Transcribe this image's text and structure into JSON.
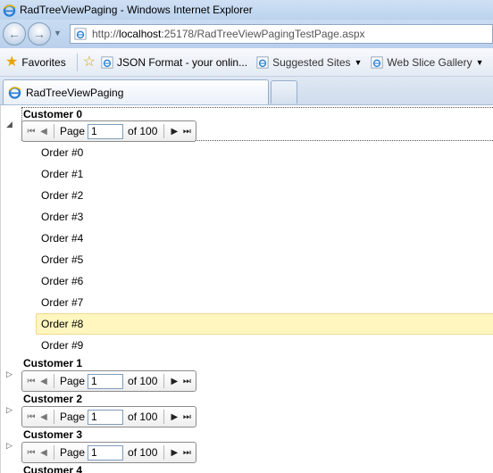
{
  "window": {
    "title": "RadTreeViewPaging - Windows Internet Explorer"
  },
  "address": {
    "url_prefix": "http://",
    "url_host": "localhost",
    "url_rest": ":25178/RadTreeViewPagingTestPage.aspx"
  },
  "favorites_bar": {
    "favorites_label": "Favorites",
    "items": [
      {
        "label": "JSON Format - your onlin...",
        "icon": "ie-page-icon"
      },
      {
        "label": "Suggested Sites",
        "icon": "ie-page-icon",
        "dropdown": true
      },
      {
        "label": "Web Slice Gallery",
        "icon": "ie-page-icon",
        "dropdown": true
      }
    ]
  },
  "tabs": [
    {
      "label": "RadTreeViewPaging",
      "active": true
    }
  ],
  "pager_labels": {
    "first": "⏮",
    "prev": "◀",
    "next": "▶",
    "last": "⏭",
    "page": "Page",
    "of_prefix": "of"
  },
  "tree": {
    "customers": [
      {
        "name": "Customer 0",
        "expanded": true,
        "page_value": "1",
        "page_total": "of 100",
        "orders": [
          "Order #0",
          "Order #1",
          "Order #2",
          "Order #3",
          "Order #4",
          "Order #5",
          "Order #6",
          "Order #7",
          "Order #8",
          "Order #9"
        ],
        "highlighted_order_index": 8
      },
      {
        "name": "Customer 1",
        "expanded": false,
        "page_value": "1",
        "page_total": "of 100"
      },
      {
        "name": "Customer 2",
        "expanded": false,
        "page_value": "1",
        "page_total": "of 100"
      },
      {
        "name": "Customer 3",
        "expanded": false,
        "page_value": "1",
        "page_total": "of 100"
      },
      {
        "name": "Customer 4",
        "expanded": false
      }
    ]
  }
}
